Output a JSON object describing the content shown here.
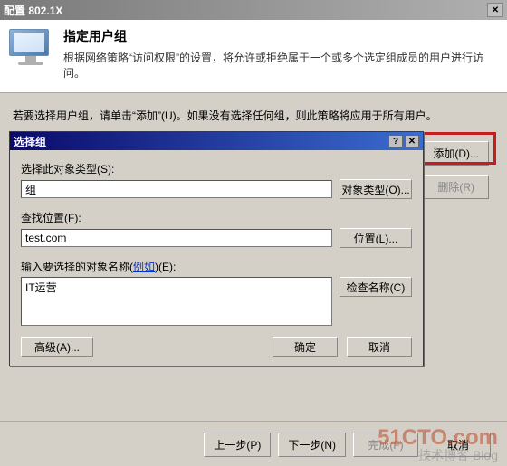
{
  "window": {
    "title": "配置 802.1X"
  },
  "header": {
    "title": "指定用户组",
    "desc": "根据网络策略“访问权限”的设置，将允许或拒绝属于一个或多个选定组成员的用户进行访问。"
  },
  "instruction": "若要选择用户组，请单击“添加”(U)。如果没有选择任何组，则此策略将应用于所有用户。",
  "sideButtons": {
    "add": "添加(D)...",
    "remove": "删除(R)"
  },
  "subdialog": {
    "title": "选择组",
    "selectTypeLabel": "选择此对象类型(S):",
    "selectTypeValue": "组",
    "objectTypeBtn": "对象类型(O)...",
    "lookInLabel": "查找位置(F):",
    "lookInValue": "test.com",
    "locationBtn": "位置(L)...",
    "enterNamesLabel_pre": "输入要选择的对象名称(",
    "enterNamesLabel_link": "例如",
    "enterNamesLabel_post": ")(E):",
    "enterNamesValue": "IT运营",
    "checkNamesBtn": "检查名称(C)",
    "advancedBtn": "高级(A)...",
    "okBtn": "确定",
    "cancelBtn": "取消"
  },
  "wizard": {
    "prev": "上一步(P)",
    "next": "下一步(N)",
    "finish": "完成(F)",
    "cancel": "取消"
  },
  "watermark": {
    "line1": "51CTO.com",
    "line2": "技术博客 Blog"
  }
}
